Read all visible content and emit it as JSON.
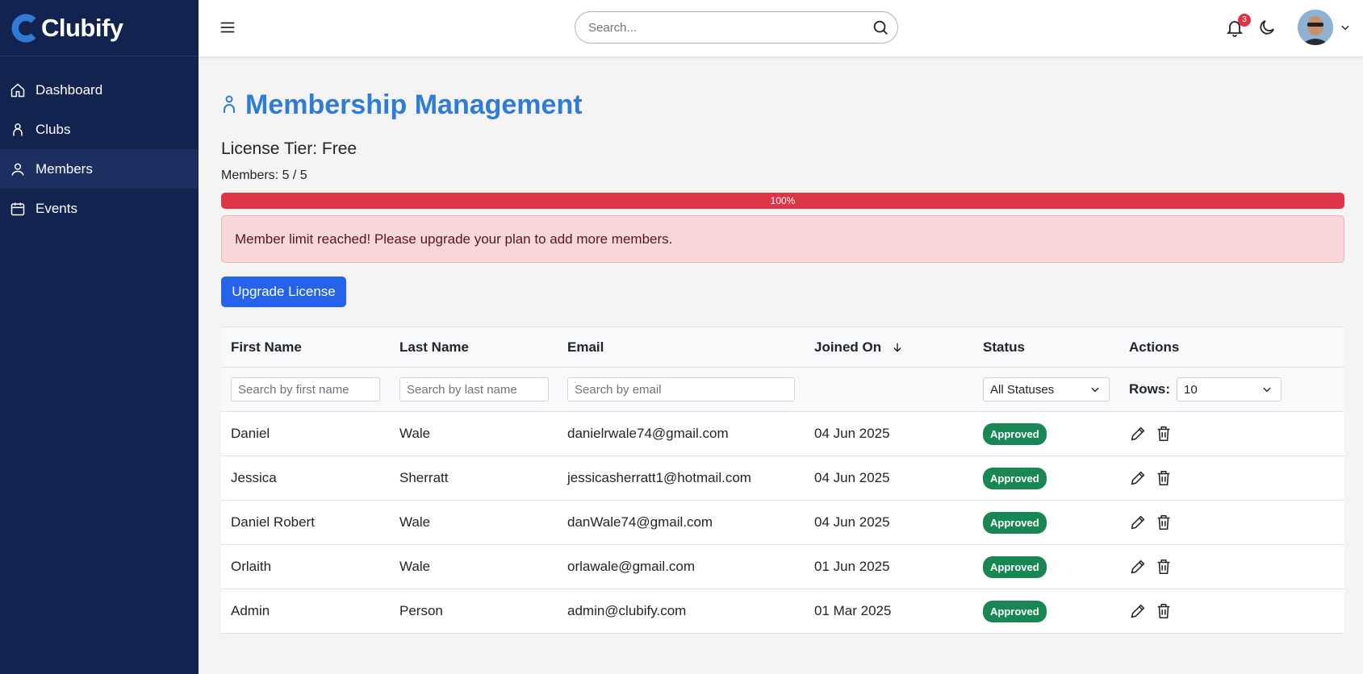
{
  "brand": {
    "name": "Clubify",
    "color": "#2f7bd6"
  },
  "sidebar": {
    "items": [
      {
        "label": "Dashboard",
        "icon": "home-icon"
      },
      {
        "label": "Clubs",
        "icon": "person-icon"
      },
      {
        "label": "Members",
        "icon": "user-icon",
        "active": true
      },
      {
        "label": "Events",
        "icon": "calendar-icon"
      }
    ]
  },
  "header": {
    "search_placeholder": "Search...",
    "notification_count": "3"
  },
  "page": {
    "title": "Membership Management",
    "license_tier": "License Tier: Free",
    "members_count": "Members: 5 / 5",
    "progress_percent": 100,
    "progress_label": "100%",
    "alert_text": "Member limit reached! Please upgrade your plan to add more members.",
    "upgrade_button": "Upgrade License"
  },
  "table": {
    "columns": [
      "First Name",
      "Last Name",
      "Email",
      "Joined On",
      "Status",
      "Actions"
    ],
    "filters": {
      "first_name_placeholder": "Search by first name",
      "last_name_placeholder": "Search by last name",
      "email_placeholder": "Search by email",
      "status_value": "All Statuses",
      "rows_label": "Rows:",
      "rows_value": "10"
    },
    "rows": [
      {
        "first": "Daniel",
        "last": "Wale",
        "email": "danielrwale74@gmail.com",
        "joined": "04 Jun 2025",
        "status": "Approved"
      },
      {
        "first": "Jessica",
        "last": "Sherratt",
        "email": "jessicasherratt1@hotmail.com",
        "joined": "04 Jun 2025",
        "status": "Approved"
      },
      {
        "first": "Daniel Robert",
        "last": "Wale",
        "email": "danWale74@gmail.com",
        "joined": "04 Jun 2025",
        "status": "Approved"
      },
      {
        "first": "Orlaith",
        "last": "Wale",
        "email": "orlawale@gmail.com",
        "joined": "01 Jun 2025",
        "status": "Approved"
      },
      {
        "first": "Admin",
        "last": "Person",
        "email": "admin@clubify.com",
        "joined": "01 Mar 2025",
        "status": "Approved"
      }
    ]
  },
  "colors": {
    "sidebar": "#12234f",
    "accent": "#2563eb",
    "danger": "#dc3545",
    "success": "#198754"
  }
}
